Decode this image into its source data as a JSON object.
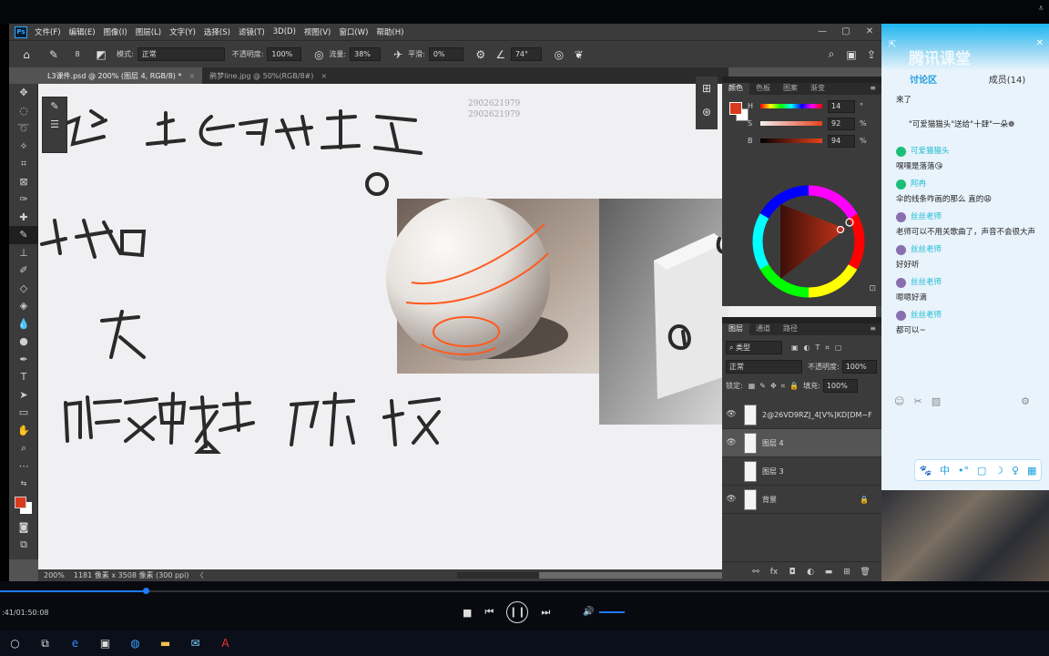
{
  "menubar": {
    "items": [
      "文件(F)",
      "编辑(E)",
      "图像(I)",
      "图层(L)",
      "文字(Y)",
      "选择(S)",
      "滤镜(T)",
      "3D(D)",
      "视图(V)",
      "窗口(W)",
      "帮助(H)"
    ]
  },
  "options": {
    "mode_label": "模式:",
    "mode": "正常",
    "opacity_label": "不透明度:",
    "opacity": "100%",
    "flow_label": "流量:",
    "flow": "38%",
    "smooth_label": "平滑:",
    "smooth": "0%",
    "angle": "74°",
    "brush_size": "8"
  },
  "tabs": [
    {
      "label": "L3课件.psd @ 200% (图层 4, RGB/8) *",
      "close": "×"
    },
    {
      "label": "鹃梦line.jpg @ 50%(RGB/8#)",
      "close": "×"
    }
  ],
  "canvas": {
    "watermark": [
      "2902621979",
      "2902621979"
    ],
    "sketch_words": [
      "上色反显造",
      "人知",
      "灰",
      "明暗交界线",
      "反光",
      "投影"
    ]
  },
  "status": {
    "zoom": "200%",
    "doc_info": "1181 像素 x 3508 像素 (300 ppi)",
    "arrow": "〈"
  },
  "color_panel": {
    "tabs": [
      "颜色",
      "色板",
      "图案",
      "渐变"
    ],
    "h_label": "H",
    "h": "14",
    "h_unit": "°",
    "s_label": "S",
    "s": "92",
    "s_unit": "%",
    "b_label": "B",
    "b": "94",
    "b_unit": "%",
    "fg_color": "#d93a1d"
  },
  "layers_panel": {
    "tabs": [
      "图层",
      "通道",
      "路径"
    ],
    "filter": "类型",
    "blend": "正常",
    "opacity_label": "不透明度:",
    "opacity": "100%",
    "lock_label": "锁定:",
    "fill_label": "填充:",
    "fill": "100%",
    "layers": [
      {
        "name": "2@26VD9RZJ_4[V%]KD[DM~F",
        "visible": true
      },
      {
        "name": "图层 4",
        "visible": true,
        "selected": true
      },
      {
        "name": "图层 3",
        "visible": false
      },
      {
        "name": "背景",
        "visible": true,
        "locked": true
      }
    ]
  },
  "chat": {
    "brand": "腾讯课堂",
    "tab_discussion": "讨论区",
    "tab_members": "成员(14)",
    "messages": [
      {
        "type": "text",
        "text": "来了"
      },
      {
        "type": "system",
        "text": "\"可爱猫猫头\"送给\"十肆\"一朵❁"
      },
      {
        "type": "name",
        "name": "可爱猫猫头",
        "teacher": false
      },
      {
        "type": "text",
        "text": "嘿嘿是落落😘"
      },
      {
        "type": "name",
        "name": "阿冉",
        "teacher": false
      },
      {
        "type": "text",
        "text": "伞的线条咋画的那么 直的😩"
      },
      {
        "type": "name",
        "name": "丝丝老师",
        "teacher": true
      },
      {
        "type": "text",
        "text": "老师可以不用关歌曲了，声音不会很大声"
      },
      {
        "type": "name",
        "name": "丝丝老师",
        "teacher": true
      },
      {
        "type": "text",
        "text": "好好听"
      },
      {
        "type": "name",
        "name": "丝丝老师",
        "teacher": true
      },
      {
        "type": "text",
        "text": "嗯嗯好滴"
      },
      {
        "type": "name",
        "name": "丝丝老师",
        "teacher": true
      },
      {
        "type": "text",
        "text": "都可以~"
      }
    ],
    "bottom_icons": [
      "🐾",
      "中",
      "•°",
      "▢",
      "☽",
      "♀",
      "▦"
    ]
  },
  "player": {
    "time": ":41/01:50:08",
    "progress": 0.139
  }
}
